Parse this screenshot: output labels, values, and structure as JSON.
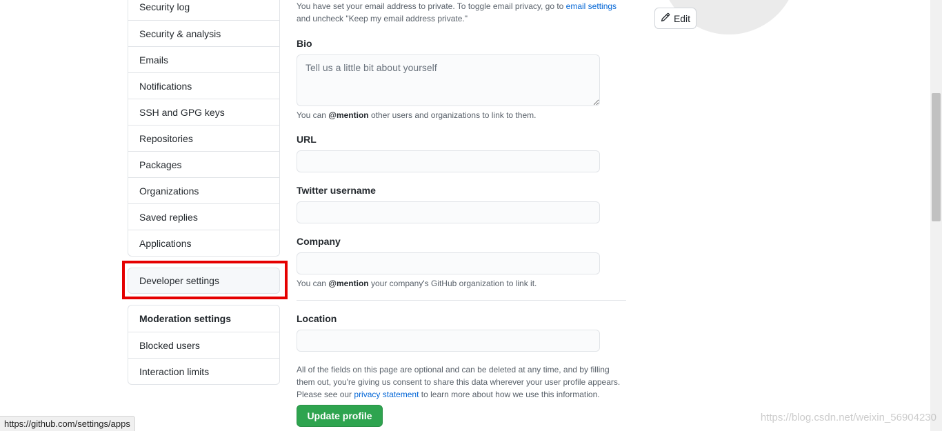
{
  "sidebar": {
    "items": [
      {
        "label": "Security log"
      },
      {
        "label": "Security & analysis"
      },
      {
        "label": "Emails"
      },
      {
        "label": "Notifications"
      },
      {
        "label": "SSH and GPG keys"
      },
      {
        "label": "Repositories"
      },
      {
        "label": "Packages"
      },
      {
        "label": "Organizations"
      },
      {
        "label": "Saved replies"
      },
      {
        "label": "Applications"
      }
    ],
    "developer_settings": "Developer settings",
    "moderation": {
      "heading": "Moderation settings",
      "items": [
        {
          "label": "Blocked users"
        },
        {
          "label": "Interaction limits"
        }
      ]
    },
    "highlight_color": "#e50000"
  },
  "main": {
    "email_note_prefix": "You have set your email address to private. To toggle email privacy, go to ",
    "email_note_link": "email settings",
    "email_note_suffix": "and uncheck \"Keep my email address private.\"",
    "bio": {
      "label": "Bio",
      "placeholder": "Tell us a little bit about yourself",
      "hint_prefix": "You can ",
      "hint_bold": "@mention",
      "hint_suffix": " other users and organizations to link to them."
    },
    "url": {
      "label": "URL",
      "value": ""
    },
    "twitter": {
      "label": "Twitter username",
      "value": ""
    },
    "company": {
      "label": "Company",
      "value": "",
      "hint_prefix": "You can ",
      "hint_bold": "@mention",
      "hint_suffix": " your company's GitHub organization to link it."
    },
    "location": {
      "label": "Location",
      "value": ""
    },
    "footer_note_line1": "All of the fields on this page are optional and can be deleted at any time, and by filling",
    "footer_note_line2": "them out, you're giving us consent to share this data wherever your user profile appears.",
    "footer_note_prefix": "Please see our ",
    "footer_note_link": "privacy statement",
    "footer_note_suffix": " to learn more about how we use this information.",
    "update_button": "Update profile",
    "update_button_color": "#2ea44f"
  },
  "avatar": {
    "edit_label": "Edit",
    "edit_icon": "pencil-icon"
  },
  "status_bar": {
    "url": "https://github.com/settings/apps"
  },
  "watermark": "https://blog.csdn.net/weixin_56904230"
}
